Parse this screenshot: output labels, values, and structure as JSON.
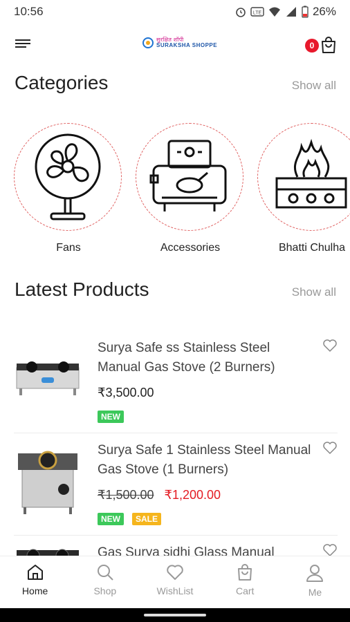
{
  "status_bar": {
    "time": "10:56",
    "battery": "26%",
    "network_label": "LTE"
  },
  "header": {
    "logo_line1": "सुरक्षित शॉपी",
    "logo_line2": "SURAKSHA SHOPPE",
    "cart_count": "0"
  },
  "categories": {
    "title": "Categories",
    "show_all": "Show all",
    "items": [
      {
        "label": "Fans",
        "icon": "fan-icon"
      },
      {
        "label": "Accessories",
        "icon": "oven-accessories-icon"
      },
      {
        "label": "Bhatti Chulha",
        "icon": "bhatti-chulha-icon"
      }
    ]
  },
  "latest": {
    "title": "Latest Products",
    "show_all": "Show all",
    "products": [
      {
        "name": "Surya Safe ss Stainless Steel Manual Gas Stove  (2 Burners)",
        "price": "₹3,500.00",
        "old_price": "",
        "badges": [
          "NEW"
        ]
      },
      {
        "name": "Surya Safe 1 Stainless Steel Manual Gas Stove  (1 Burners)",
        "price": "₹1,200.00",
        "old_price": "₹1,500.00",
        "badges": [
          "NEW",
          "SALE"
        ]
      },
      {
        "name": "Gas Surya sidhi Glass Manual",
        "price": "",
        "old_price": "",
        "badges": []
      }
    ]
  },
  "nav": {
    "items": [
      {
        "label": "Home",
        "icon": "home-icon"
      },
      {
        "label": "Shop",
        "icon": "search-icon"
      },
      {
        "label": "WishList",
        "icon": "heart-icon"
      },
      {
        "label": "Cart",
        "icon": "cart-icon"
      },
      {
        "label": "Me",
        "icon": "user-icon"
      }
    ],
    "active": "Home"
  },
  "colors": {
    "accent_red": "#e41b23",
    "badge_new": "#3cc85a",
    "badge_sale": "#f5b51d"
  }
}
